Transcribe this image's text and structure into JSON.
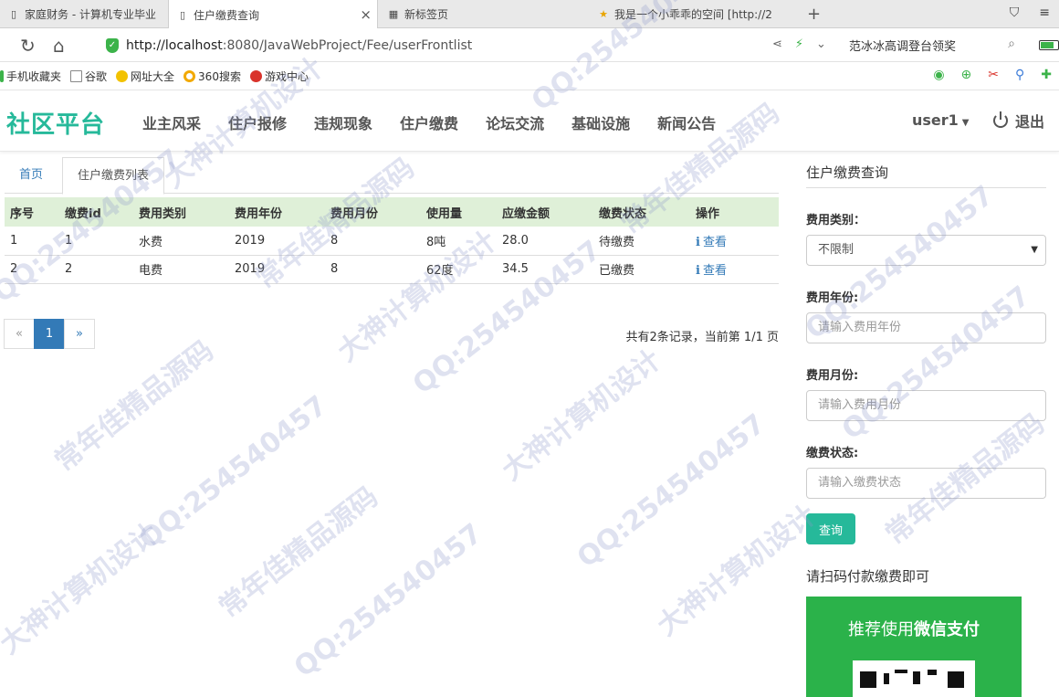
{
  "browser": {
    "tabs": [
      {
        "title": "家庭财务 - 计算机专业毕业"
      },
      {
        "title": "住户缴费查询",
        "close": "×"
      },
      {
        "title": "新标签页"
      },
      {
        "title": "我是一个小乖乖的空间 [http://2"
      }
    ],
    "new_tab": "+",
    "url_host": "http://localhost",
    "url_rest": ":8080/JavaWebProject/Fee/userFrontlist",
    "search_text": "范冰冰高调登台领奖",
    "bookmarks": [
      "手机收藏夹",
      "谷歌",
      "网址大全",
      "360搜索",
      "游戏中心"
    ]
  },
  "navbar": {
    "brand": "社区平台",
    "menu": [
      "业主风采",
      "住户报修",
      "违规现象",
      "住户缴费",
      "论坛交流",
      "基础设施",
      "新闻公告"
    ],
    "user": "user1",
    "logout": "退出"
  },
  "breadcrumb": {
    "home": "首页",
    "current": "住户缴费列表"
  },
  "table": {
    "headers": [
      "序号",
      "缴费id",
      "费用类别",
      "费用年份",
      "费用月份",
      "使用量",
      "应缴金额",
      "缴费状态",
      "操作"
    ],
    "rows": [
      [
        "1",
        "1",
        "水费",
        "2019",
        "8",
        "8吨",
        "28.0",
        "待缴费",
        "查看"
      ],
      [
        "2",
        "2",
        "电费",
        "2019",
        "8",
        "62度",
        "34.5",
        "已缴费",
        "查看"
      ]
    ]
  },
  "pager": {
    "prev": "«",
    "current": "1",
    "next": "»",
    "info": "共有2条记录，当前第 1/1 页"
  },
  "sidebar": {
    "title": "住户缴费查询",
    "fee_type_label": "费用类别：",
    "fee_type_value": "不限制",
    "year_label": "费用年份:",
    "year_placeholder": "请输入费用年份",
    "month_label": "费用月份:",
    "month_placeholder": "请输入费用月份",
    "status_label": "缴费状态:",
    "status_placeholder": "请输入缴费状态",
    "query_button": "查询",
    "pay_tip": "请扫码付款缴费即可",
    "pay_card_prefix": "推荐使用",
    "pay_card_bold": "微信支付"
  },
  "watermark": [
    "常年佳精品源码",
    "QQ:254540457",
    "大神计算机设计"
  ],
  "colors": {
    "brand": "#26b99a",
    "table_header": "#dff0d8",
    "link": "#337ab7",
    "wechat_green": "#2bb24a"
  }
}
